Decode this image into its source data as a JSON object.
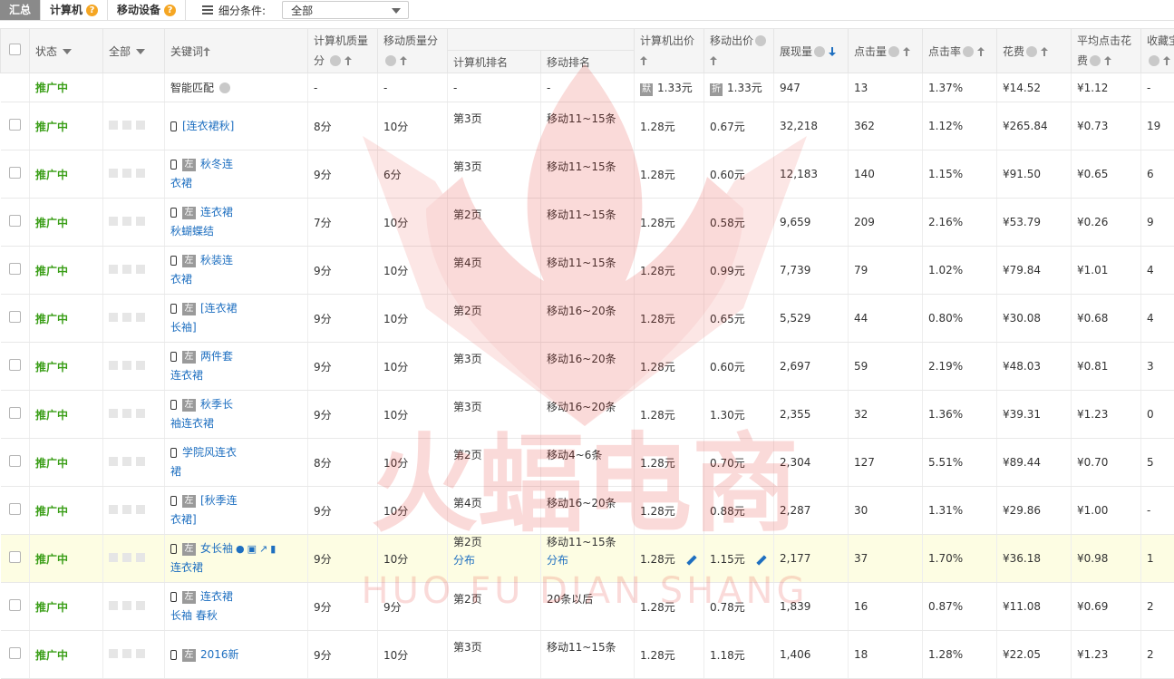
{
  "tabs": {
    "summary": "汇总",
    "pc": "计算机",
    "mobile": "移动设备",
    "filter_label": "细分条件:",
    "filter_value": "全部"
  },
  "headers": {
    "status": "状态",
    "all": "全部",
    "keyword": "关键词",
    "pc_quality_1": "计算机质量",
    "pc_quality_2": "分",
    "mob_quality": "移动质量分",
    "pc_rank": "计算机排名",
    "mob_rank": "移动排名",
    "pc_bid": "计算机出价",
    "mob_bid": "移动出价",
    "impressions": "展现量",
    "clicks": "点击量",
    "ctr": "点击率",
    "cost": "花费",
    "avg_cpc_1": "平均点击花",
    "avg_cpc_2": "费",
    "fav": "收藏宝"
  },
  "smart_row": {
    "status": "推广中",
    "keyword": "智能匹配",
    "pc_quality": "-",
    "mob_quality": "-",
    "pc_rank": "-",
    "mob_rank": "-",
    "pc_badge": "默",
    "pc_bid": "1.33元",
    "mob_badge": "折",
    "mob_bid": "1.33元",
    "impressions": "947",
    "clicks": "13",
    "ctr": "1.37%",
    "cost": "¥14.52",
    "avg_cpc": "¥1.12",
    "fav": "-"
  },
  "zuo_label": "左",
  "fenbu_label": "分布",
  "rows": [
    {
      "status": "推广中",
      "kw1": "[连衣裙秋]",
      "kw2": "",
      "zuo": false,
      "pcq": "8分",
      "mq": "10分",
      "pcr": "第3页",
      "mr": "移动11~15条",
      "pcb": "1.28元",
      "mb": "0.67元",
      "imp": "32,218",
      "clk": "362",
      "ctr": "1.12%",
      "cost": "¥265.84",
      "cpc": "¥0.73",
      "fav": "19"
    },
    {
      "status": "推广中",
      "kw1": "秋冬连",
      "kw2": "衣裙",
      "zuo": true,
      "pcq": "9分",
      "mq": "6分",
      "pcr": "第3页",
      "mr": "移动11~15条",
      "pcb": "1.28元",
      "mb": "0.60元",
      "imp": "12,183",
      "clk": "140",
      "ctr": "1.15%",
      "cost": "¥91.50",
      "cpc": "¥0.65",
      "fav": "6"
    },
    {
      "status": "推广中",
      "kw1": "连衣裙",
      "kw2": "秋蝴蝶结",
      "zuo": true,
      "pcq": "7分",
      "mq": "10分",
      "pcr": "第2页",
      "mr": "移动11~15条",
      "pcb": "1.28元",
      "mb": "0.58元",
      "imp": "9,659",
      "clk": "209",
      "ctr": "2.16%",
      "cost": "¥53.79",
      "cpc": "¥0.26",
      "fav": "9"
    },
    {
      "status": "推广中",
      "kw1": "秋装连",
      "kw2": "衣裙",
      "zuo": true,
      "pcq": "9分",
      "mq": "10分",
      "pcr": "第4页",
      "mr": "移动11~15条",
      "pcb": "1.28元",
      "mb": "0.99元",
      "imp": "7,739",
      "clk": "79",
      "ctr": "1.02%",
      "cost": "¥79.84",
      "cpc": "¥1.01",
      "fav": "4"
    },
    {
      "status": "推广中",
      "kw1": "[连衣裙",
      "kw2": "长袖]",
      "zuo": true,
      "pcq": "9分",
      "mq": "10分",
      "pcr": "第2页",
      "mr": "移动16~20条",
      "pcb": "1.28元",
      "mb": "0.65元",
      "imp": "5,529",
      "clk": "44",
      "ctr": "0.80%",
      "cost": "¥30.08",
      "cpc": "¥0.68",
      "fav": "4"
    },
    {
      "status": "推广中",
      "kw1": "两件套",
      "kw2": "连衣裙",
      "zuo": true,
      "pcq": "9分",
      "mq": "10分",
      "pcr": "第3页",
      "mr": "移动16~20条",
      "pcb": "1.28元",
      "mb": "0.60元",
      "imp": "2,697",
      "clk": "59",
      "ctr": "2.19%",
      "cost": "¥48.03",
      "cpc": "¥0.81",
      "fav": "3"
    },
    {
      "status": "推广中",
      "kw1": "秋季长",
      "kw2": "袖连衣裙",
      "zuo": true,
      "pcq": "9分",
      "mq": "10分",
      "pcr": "第3页",
      "mr": "移动16~20条",
      "pcb": "1.28元",
      "mb": "1.30元",
      "imp": "2,355",
      "clk": "32",
      "ctr": "1.36%",
      "cost": "¥39.31",
      "cpc": "¥1.23",
      "fav": "0"
    },
    {
      "status": "推广中",
      "kw1": "学院风连衣",
      "kw2": "裙",
      "zuo": false,
      "pcq": "8分",
      "mq": "10分",
      "pcr": "第2页",
      "mr": "移动4~6条",
      "pcb": "1.28元",
      "mb": "0.70元",
      "imp": "2,304",
      "clk": "127",
      "ctr": "5.51%",
      "cost": "¥89.44",
      "cpc": "¥0.70",
      "fav": "5"
    },
    {
      "status": "推广中",
      "kw1": "[秋季连",
      "kw2": "衣裙]",
      "zuo": true,
      "pcq": "9分",
      "mq": "10分",
      "pcr": "第4页",
      "mr": "移动16~20条",
      "pcb": "1.28元",
      "mb": "0.88元",
      "imp": "2,287",
      "clk": "30",
      "ctr": "1.31%",
      "cost": "¥29.86",
      "cpc": "¥1.00",
      "fav": "-"
    },
    {
      "status": "推广中",
      "kw1": "女长袖",
      "kw2": "连衣裙",
      "zuo": true,
      "hl": true,
      "pcq": "9分",
      "mq": "10分",
      "pcr": "第2页",
      "mr": "移动11~15条",
      "pcb": "1.28元",
      "mb": "1.15元",
      "imp": "2,177",
      "clk": "37",
      "ctr": "1.70%",
      "cost": "¥36.18",
      "cpc": "¥0.98",
      "fav": "1"
    },
    {
      "status": "推广中",
      "kw1": "连衣裙",
      "kw2": "长袖 春秋",
      "zuo": true,
      "pcq": "9分",
      "mq": "9分",
      "pcr": "第2页",
      "mr": "20条以后",
      "pcb": "1.28元",
      "mb": "0.78元",
      "imp": "1,839",
      "clk": "16",
      "ctr": "0.87%",
      "cost": "¥11.08",
      "cpc": "¥0.69",
      "fav": "2"
    },
    {
      "status": "推广中",
      "kw1": "2016新",
      "kw2": "",
      "zuo": true,
      "pcq": "9分",
      "mq": "10分",
      "pcr": "第3页",
      "mr": "移动11~15条",
      "pcb": "1.28元",
      "mb": "1.18元",
      "imp": "1,406",
      "clk": "18",
      "ctr": "1.28%",
      "cost": "¥22.05",
      "cpc": "¥1.23",
      "fav": "2"
    }
  ],
  "watermark": {
    "cn": "火蝠电商",
    "en": "HUO FU DIAN SHANG"
  }
}
